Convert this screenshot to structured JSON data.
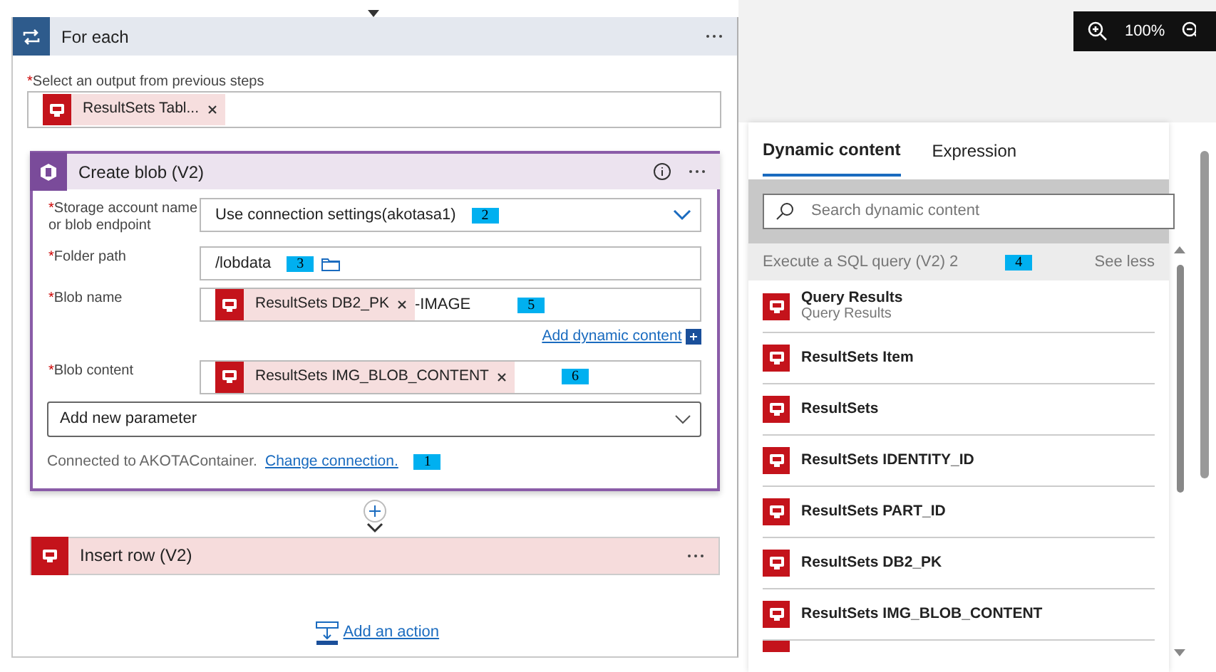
{
  "zoom_toolbar": {
    "level_text": "100%"
  },
  "for_each": {
    "title": "For each",
    "output_label": "Select an output from previous steps",
    "required_mark": "*",
    "tokens": [
      {
        "label": "ResultSets Tabl..."
      }
    ]
  },
  "create_blob": {
    "title": "Create blob (V2)",
    "fields": [
      {
        "kind": "select",
        "label": "Storage account name or blob endpoint",
        "required_mark": "*",
        "value": "Use connection settings(akotasa1)",
        "marker": "2"
      },
      {
        "kind": "folder",
        "label": "Folder path",
        "required_mark": "*",
        "value": "/lobdata",
        "marker": "3"
      },
      {
        "kind": "tokens",
        "label": "Blob name",
        "required_mark": "*",
        "tokens": [
          {
            "label": "ResultSets DB2_PK"
          }
        ],
        "suffix": "-IMAGE",
        "marker": "5",
        "link": "Add dynamic content"
      },
      {
        "kind": "tokens",
        "label": "Blob content",
        "required_mark": "*",
        "tokens": [
          {
            "label": "ResultSets IMG_BLOB_CONTENT"
          }
        ],
        "marker": "6"
      }
    ],
    "add_parameter": "Add new parameter",
    "connected_text": "Connected to AKOTAContainer.",
    "change_link": "Change connection.",
    "connected_marker": "1"
  },
  "insert_row": {
    "title": "Insert row (V2)"
  },
  "add_action": "Add an action",
  "dynamic_panel": {
    "tabs": [
      {
        "label": "Dynamic content",
        "selected": true
      },
      {
        "label": "Expression",
        "selected": false
      }
    ],
    "search_placeholder": "Search dynamic content",
    "section": {
      "title": "Execute a SQL query (V2) 2",
      "marker": "4",
      "toggle": "See less"
    },
    "items": [
      {
        "title": "Query Results",
        "subtitle": "Query Results"
      },
      {
        "title": "ResultSets Item"
      },
      {
        "title": "ResultSets"
      },
      {
        "title": "ResultSets IDENTITY_ID"
      },
      {
        "title": "ResultSets PART_ID"
      },
      {
        "title": "ResultSets DB2_PK"
      },
      {
        "title": "ResultSets IMG_BLOB_CONTENT"
      }
    ]
  }
}
